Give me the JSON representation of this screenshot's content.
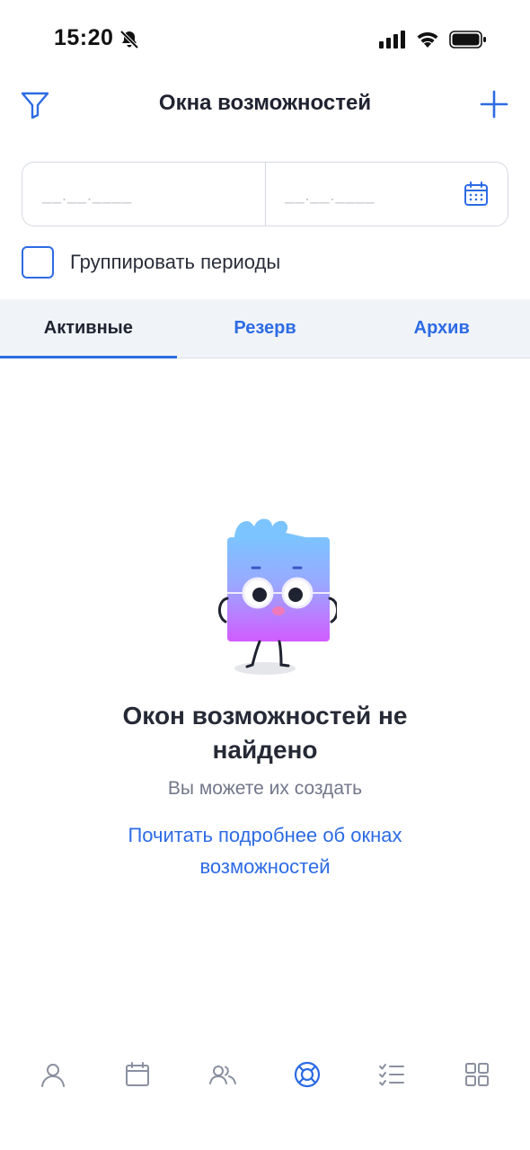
{
  "status_bar": {
    "time": "15:20",
    "icons": [
      "bell-slash-icon",
      "signal-icon",
      "wifi-icon",
      "battery-icon"
    ]
  },
  "header": {
    "title": "Окна возможностей",
    "left_icon": "filter-icon",
    "right_icon": "plus-icon"
  },
  "date_range": {
    "start_placeholder": "__.__.____",
    "end_placeholder": "__.__.____",
    "icon": "calendar-icon"
  },
  "group_periods": {
    "label": "Группировать периоды",
    "checked": false
  },
  "tabs": [
    {
      "label": "Активные",
      "active": true
    },
    {
      "label": "Резерв",
      "active": false
    },
    {
      "label": "Архив",
      "active": false
    }
  ],
  "empty_state": {
    "title": "Окон возможностей не найдено",
    "subtitle": "Вы можете их создать",
    "link": "Почитать подробнее об окнах возможностей"
  },
  "bottom_nav": [
    {
      "icon": "profile-icon",
      "active": false
    },
    {
      "icon": "calendar-icon",
      "active": false
    },
    {
      "icon": "users-icon",
      "active": false
    },
    {
      "icon": "lifebuoy-icon",
      "active": true
    },
    {
      "icon": "checklist-icon",
      "active": false
    },
    {
      "icon": "grid-icon",
      "active": false
    }
  ],
  "colors": {
    "accent": "#2d6be4",
    "text": "#1f2230",
    "muted": "#73778a",
    "nav_inactive": "#8a90a0",
    "tab_bg": "#f0f3f8"
  }
}
